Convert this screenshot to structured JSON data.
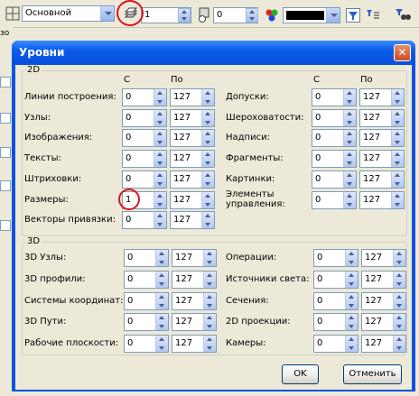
{
  "toolbar": {
    "style_combo": "Основной",
    "layer_value": "1",
    "second_value": "0",
    "color_swatch": "#000000",
    "partial_label": "зо"
  },
  "dialog": {
    "title": "Уровни",
    "close_symbol": "✕",
    "group_2d": {
      "label": "2D",
      "col_from": "С",
      "col_to": "По",
      "left_rows": [
        {
          "label": "Линии построения:",
          "from": "0",
          "to": "127"
        },
        {
          "label": "Узлы:",
          "from": "0",
          "to": "127"
        },
        {
          "label": "Изображения:",
          "from": "0",
          "to": "127"
        },
        {
          "label": "Тексты:",
          "from": "0",
          "to": "127"
        },
        {
          "label": "Штриховки:",
          "from": "0",
          "to": "127"
        },
        {
          "label": "Размеры:",
          "from": "1",
          "to": "127"
        },
        {
          "label": "Векторы привязки:",
          "from": "0",
          "to": "127"
        }
      ],
      "right_rows": [
        {
          "label": "Допуски:",
          "from": "0",
          "to": "127"
        },
        {
          "label": "Шероховатости:",
          "from": "0",
          "to": "127"
        },
        {
          "label": "Надписи:",
          "from": "0",
          "to": "127"
        },
        {
          "label": "Фрагменты:",
          "from": "0",
          "to": "127"
        },
        {
          "label": "Картинки:",
          "from": "0",
          "to": "127"
        },
        {
          "label": "Элементы\nуправления:",
          "from": "0",
          "to": "127"
        }
      ]
    },
    "group_3d": {
      "label": "3D",
      "left_rows": [
        {
          "label": "3D Узлы:",
          "from": "0",
          "to": "127"
        },
        {
          "label": "3D профили:",
          "from": "0",
          "to": "127"
        },
        {
          "label": "Системы координат:",
          "from": "0",
          "to": "127"
        },
        {
          "label": "3D Пути:",
          "from": "0",
          "to": "127"
        },
        {
          "label": "Рабочие плоскости:",
          "from": "0",
          "to": "127"
        }
      ],
      "right_rows": [
        {
          "label": "Операции:",
          "from": "0",
          "to": "127"
        },
        {
          "label": "Источники света:",
          "from": "0",
          "to": "127"
        },
        {
          "label": "Сечения:",
          "from": "0",
          "to": "127"
        },
        {
          "label": "2D проекции:",
          "from": "0",
          "to": "127"
        },
        {
          "label": "Камеры:",
          "from": "0",
          "to": "127"
        }
      ]
    },
    "ok_label": "OK",
    "cancel_label": "Отменить"
  },
  "highlight_color": "#d9141c"
}
